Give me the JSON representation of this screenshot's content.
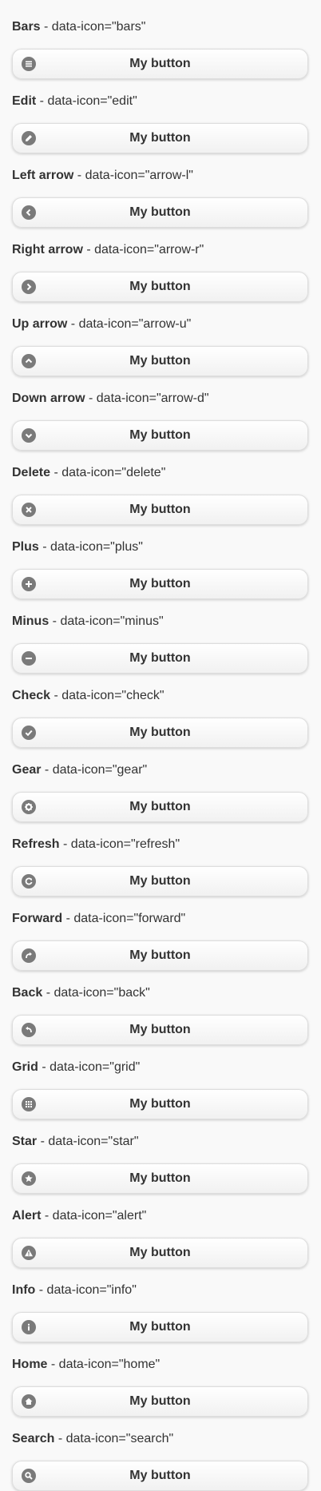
{
  "items": [
    {
      "name": "Bars",
      "attr": " - data-icon=\"bars\"",
      "button": "My button",
      "icon": "bars-icon"
    },
    {
      "name": "Edit",
      "attr": " - data-icon=\"edit\"",
      "button": "My button",
      "icon": "edit-icon"
    },
    {
      "name": "Left arrow",
      "attr": " - data-icon=\"arrow-l\"",
      "button": "My button",
      "icon": "arrow-l-icon"
    },
    {
      "name": "Right arrow",
      "attr": " - data-icon=\"arrow-r\"",
      "button": "My button",
      "icon": "arrow-r-icon"
    },
    {
      "name": "Up arrow",
      "attr": " - data-icon=\"arrow-u\"",
      "button": "My button",
      "icon": "arrow-u-icon"
    },
    {
      "name": "Down arrow",
      "attr": " - data-icon=\"arrow-d\"",
      "button": "My button",
      "icon": "arrow-d-icon"
    },
    {
      "name": "Delete",
      "attr": " - data-icon=\"delete\"",
      "button": "My button",
      "icon": "delete-icon"
    },
    {
      "name": "Plus",
      "attr": " - data-icon=\"plus\"",
      "button": "My button",
      "icon": "plus-icon"
    },
    {
      "name": "Minus",
      "attr": " - data-icon=\"minus\"",
      "button": "My button",
      "icon": "minus-icon"
    },
    {
      "name": "Check",
      "attr": " - data-icon=\"check\"",
      "button": "My button",
      "icon": "check-icon"
    },
    {
      "name": "Gear",
      "attr": " - data-icon=\"gear\"",
      "button": "My button",
      "icon": "gear-icon"
    },
    {
      "name": "Refresh",
      "attr": " - data-icon=\"refresh\"",
      "button": "My button",
      "icon": "refresh-icon"
    },
    {
      "name": "Forward",
      "attr": " - data-icon=\"forward\"",
      "button": "My button",
      "icon": "forward-icon"
    },
    {
      "name": "Back",
      "attr": " - data-icon=\"back\"",
      "button": "My button",
      "icon": "back-icon"
    },
    {
      "name": "Grid",
      "attr": " - data-icon=\"grid\"",
      "button": "My button",
      "icon": "grid-icon"
    },
    {
      "name": "Star",
      "attr": " - data-icon=\"star\"",
      "button": "My button",
      "icon": "star-icon"
    },
    {
      "name": "Alert",
      "attr": " - data-icon=\"alert\"",
      "button": "My button",
      "icon": "alert-icon"
    },
    {
      "name": "Info",
      "attr": " - data-icon=\"info\"",
      "button": "My button",
      "icon": "info-icon"
    },
    {
      "name": "Home",
      "attr": " - data-icon=\"home\"",
      "button": "My button",
      "icon": "home-icon"
    },
    {
      "name": "Search",
      "attr": " - data-icon=\"search\"",
      "button": "My button",
      "icon": "search-icon"
    }
  ]
}
